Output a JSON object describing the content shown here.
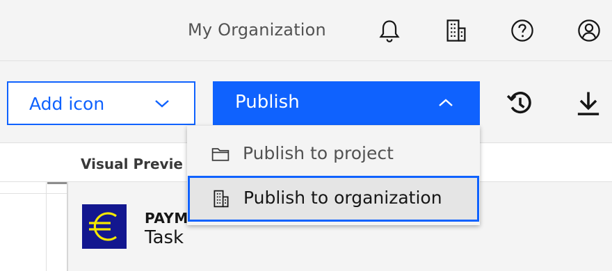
{
  "header": {
    "org_name": "My Organization",
    "icons": [
      "bell-icon",
      "building-icon",
      "help-icon",
      "user-avatar-icon"
    ]
  },
  "toolbar": {
    "add_icon_label": "Add icon",
    "publish_label": "Publish",
    "publish_menu_open": true,
    "icons": [
      "history-icon",
      "download-icon"
    ]
  },
  "publish_menu": {
    "items": [
      {
        "label": "Publish to project",
        "icon": "folder-icon",
        "focused": false
      },
      {
        "label": "Publish to organization",
        "icon": "building-icon",
        "focused": true
      }
    ]
  },
  "content": {
    "visual_preview_label": "Visual Previe",
    "card": {
      "icon": "euro-icon",
      "title": "PAYM",
      "subtitle": "Task"
    }
  },
  "colors": {
    "accent": "#0f62fe",
    "euro_icon_bg": "#13178f",
    "euro_symbol": "#f5e800",
    "page_bg": "#f4f4f4",
    "menu_focus_bg": "#e5e5e5"
  }
}
